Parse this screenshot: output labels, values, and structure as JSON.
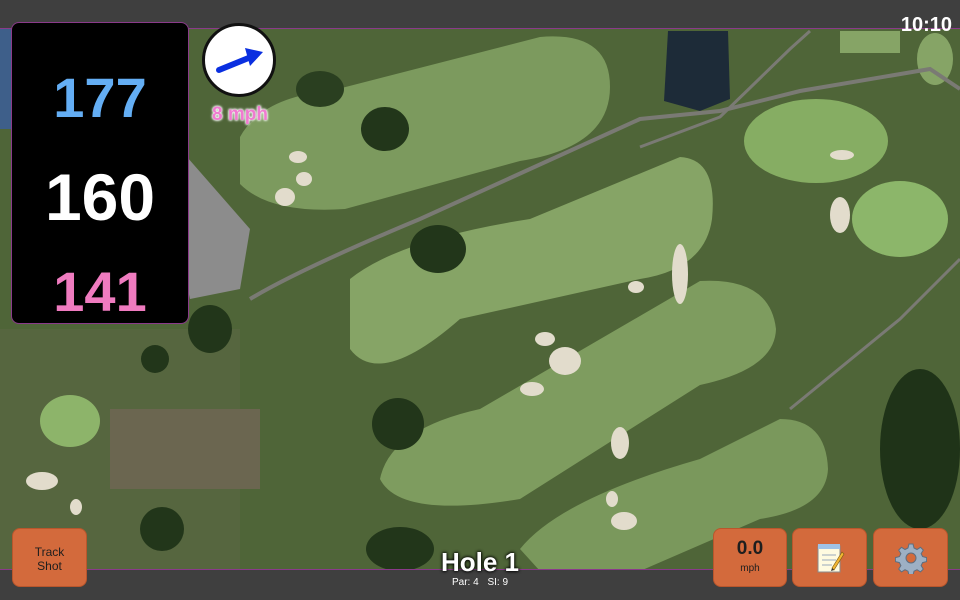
{
  "status": {
    "time": "10:10"
  },
  "distances": {
    "back": "177",
    "middle": "160",
    "front": "141"
  },
  "wind": {
    "speed_label": "8 mph",
    "direction_icon": "wind-arrow-icon"
  },
  "hole": {
    "title": "Hole 1",
    "par_label": "Par: 4",
    "si_label": "SI: 9"
  },
  "buttons": {
    "track_shot_line1": "Track",
    "track_shot_line2": "Shot",
    "speed_value": "0.0",
    "speed_unit": "mph",
    "notes_icon": "notepad-icon",
    "settings_icon": "gear-icon"
  },
  "colors": {
    "back_distance": "#64aef4",
    "middle_distance": "#ffffff",
    "front_distance": "#ef7bbf",
    "button": "#d36a3c",
    "wind_label": "#f07bd0"
  }
}
